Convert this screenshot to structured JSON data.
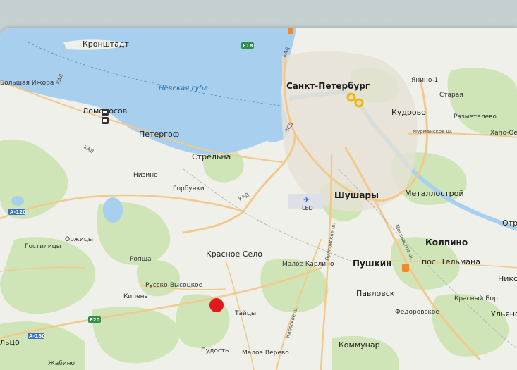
{
  "map": {
    "water": {
      "gulf": "Невская губа"
    },
    "places": {
      "spb": "Санкт-Петербург",
      "kronshtadt": "Кронштадт",
      "bolshaya_izhora": "Большая Ижора",
      "lomonosov": "Ломоносов",
      "peterhof": "Петергоф",
      "strelna": "Стрельна",
      "nizino": "Низино",
      "gorbunki": "Горбунки",
      "kudrovo": "Кудрово",
      "yanino": "Янино-1",
      "staraya": "Старая",
      "razmetelevo": "Разметелево",
      "khapo_oe": "Хапо-Ое",
      "shushary": "Шушары",
      "metallostroy": "Металлострой",
      "otr": "Отр",
      "gostilitsy": "Гостилицы",
      "orzhitsy": "Оржицы",
      "ropsha": "Ропша",
      "krasnoe_selo": "Красное Село",
      "maloe_karlino": "Малое Карлино",
      "pushkin": "Пушкин",
      "kolpino": "Колпино",
      "tel_mana": "пос. Тельмана",
      "russko_vysotskoe": "Русско-Высоцкое",
      "kipen": "Кипень",
      "taitsy": "Тайцы",
      "pavlovsk": "Павловск",
      "krasny_bor": "Красный Бор",
      "niko": "Нико",
      "fedorovskoe": "Фёдоровское",
      "ulyanovka": "Ульяно",
      "ropsha_kaltsy": "льцо",
      "pudost": "Пудость",
      "maloe_verevo": "Малое Верево",
      "kommunar": "Коммунар",
      "zhabino": "Жабино"
    },
    "roads": {
      "kad": "КАД",
      "e18": "E18",
      "e20": "E20",
      "a120": "A-120",
      "a180": "A-180",
      "zsd": "ЗСД",
      "murmansk": "Мурманское ш.",
      "moskovskoe": "Московское ш.",
      "pulkovskoe": "Пулковское ш.",
      "kievskoe": "Киевское ш."
    },
    "airport": "LED",
    "colors": {
      "water": "#a8cfee",
      "land": "#eef0e9",
      "forest": "#cfe5b7",
      "road": "#f3c98b",
      "marker": "#e0191f",
      "metro_marker": "#f2b500"
    }
  }
}
